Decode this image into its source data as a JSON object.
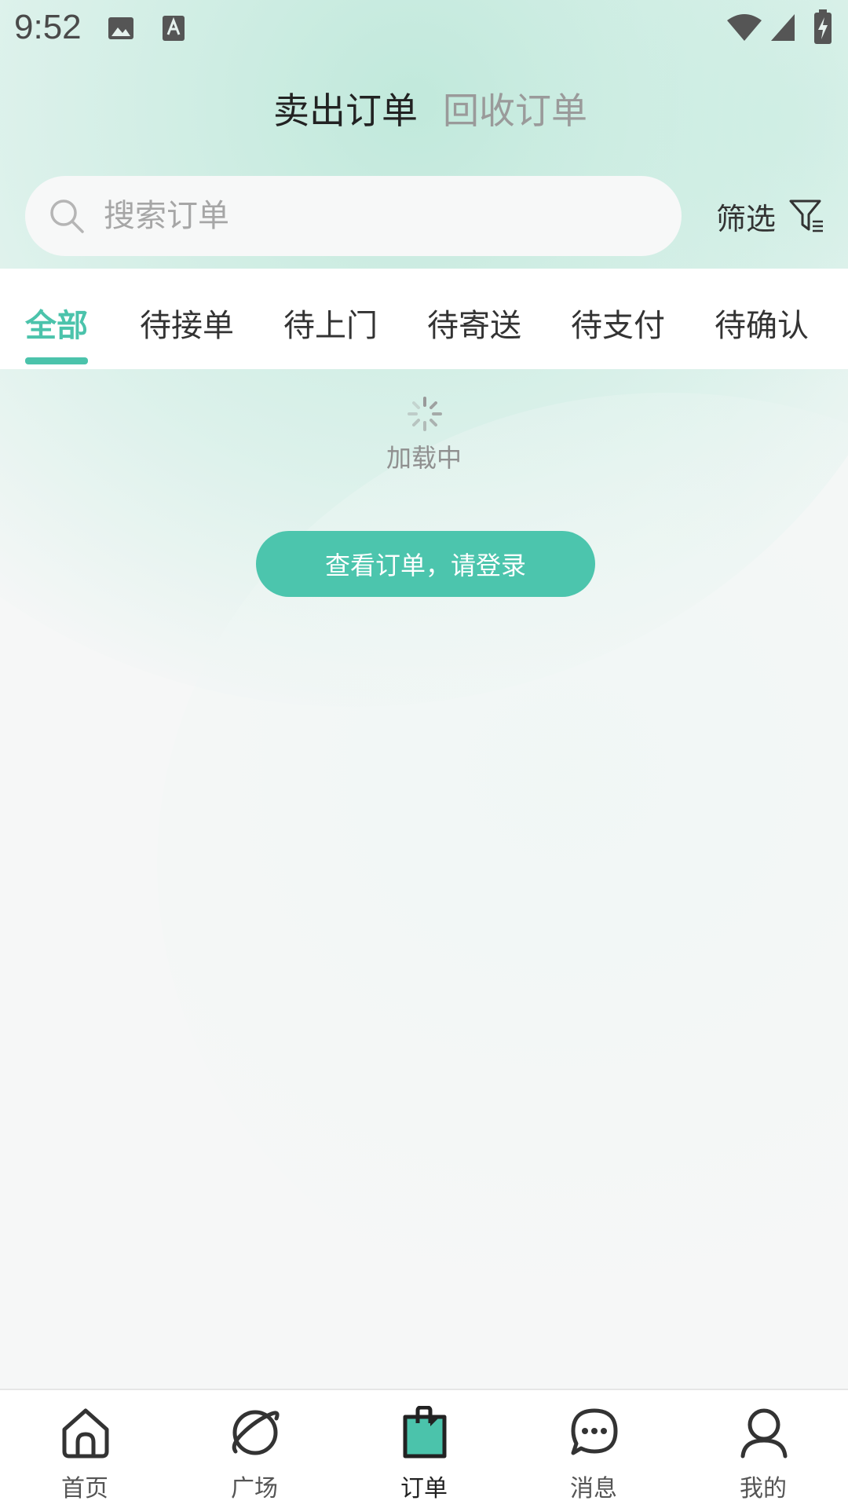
{
  "status_bar": {
    "time": "9:52",
    "icons": [
      "image-icon",
      "text-a-icon",
      "wifi-icon",
      "cell-signal-icon",
      "battery-charging-icon"
    ]
  },
  "header": {
    "tabs": [
      {
        "label": "卖出订单",
        "active": true
      },
      {
        "label": "回收订单",
        "active": false
      }
    ]
  },
  "search": {
    "placeholder": "搜索订单",
    "filter_label": "筛选"
  },
  "status_tabs": {
    "items": [
      {
        "label": "全部",
        "active": true
      },
      {
        "label": "待接单",
        "active": false
      },
      {
        "label": "待上门",
        "active": false
      },
      {
        "label": "待寄送",
        "active": false
      },
      {
        "label": "待支付",
        "active": false
      },
      {
        "label": "待确认",
        "active": false
      }
    ]
  },
  "loading": {
    "text": "加载中"
  },
  "login": {
    "button_label": "查看订单，请登录"
  },
  "bottom_nav": {
    "items": [
      {
        "label": "首页",
        "icon": "home-icon",
        "active": false
      },
      {
        "label": "广场",
        "icon": "planet-icon",
        "active": false
      },
      {
        "label": "订单",
        "icon": "order-clipboard-icon",
        "active": true
      },
      {
        "label": "消息",
        "icon": "chat-bubble-icon",
        "active": false
      },
      {
        "label": "我的",
        "icon": "user-icon",
        "active": false
      }
    ]
  },
  "colors": {
    "accent": "#4bc3ab",
    "text_primary": "#222222",
    "text_muted": "#9a9a9a"
  }
}
